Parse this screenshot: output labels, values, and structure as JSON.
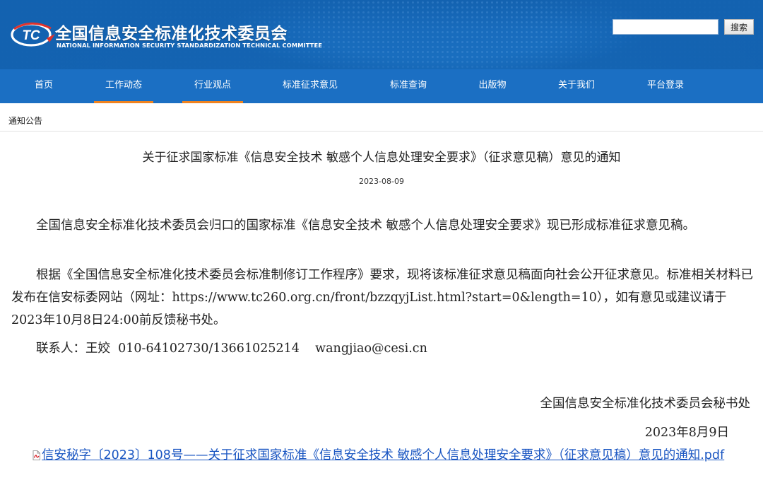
{
  "header": {
    "title_cn": "全国信息安全标准化技术委员会",
    "title_en": "NATIONAL INFORMATION SECURITY STANDARDIZATION TECHNICAL COMMITTEE",
    "logo_letters": "TC",
    "search_placeholder": "",
    "search_button": "搜索",
    "colors": {
      "header_blue": "#1362b0",
      "nav_blue": "#1b6fc3",
      "active_underline": "#f0831f",
      "logo_red": "#e0322b"
    }
  },
  "nav": {
    "items": [
      {
        "label": "首页"
      },
      {
        "label": "工作动态"
      },
      {
        "label": "行业观点"
      },
      {
        "label": "标准征求意见"
      },
      {
        "label": "标准查询"
      },
      {
        "label": "出版物"
      },
      {
        "label": "关于我们"
      },
      {
        "label": "平台登录"
      }
    ],
    "active": [
      "工作动态",
      "行业观点"
    ]
  },
  "breadcrumb": "通知公告",
  "article": {
    "title": "关于征求国家标准《信息安全技术 敏感个人信息处理安全要求》（征求意见稿）意见的通知",
    "date": "2023-08-09",
    "paragraphs": [
      "全国信息安全标准化技术委员会归口的国家标准《信息安全技术 敏感个人信息处理安全要求》现已形成标准征求意见稿。",
      "根据《全国信息安全标准化技术委员会标准制修订工作程序》要求，现将该标准征求意见稿面向社会公开征求意见。标准相关材料已发布在信安标委网站（网址：https://www.tc260.org.cn/front/bzzqyjList.html?start=0&length=10），如有意见或建议请于2023年10月8日24:00前反馈秘书处。",
      "联系人：王姣  010-64102730/13661025214    wangjiao@cesi.cn"
    ],
    "signature_org": "全国信息安全标准化技术委员会秘书处",
    "signature_date": "2023年8月9日",
    "attachment": "信安秘字〔2023〕108号——关于征求国家标准《信息安全技术 敏感个人信息处理安全要求》（征求意见稿）意见的通知.pdf",
    "attachment_icon": "pdf-icon"
  }
}
